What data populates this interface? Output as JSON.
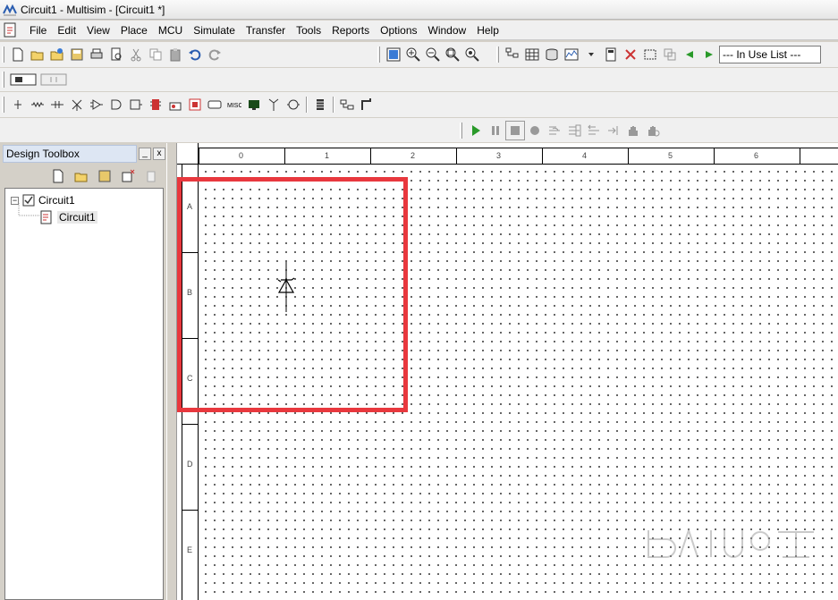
{
  "window": {
    "title": "Circuit1 - Multisim - [Circuit1 *]"
  },
  "menu": [
    "File",
    "Edit",
    "View",
    "Place",
    "MCU",
    "Simulate",
    "Transfer",
    "Tools",
    "Reports",
    "Options",
    "Window",
    "Help"
  ],
  "toolbar": {
    "in_use_list": "--- In Use List ---"
  },
  "toolbox": {
    "title": "Design Toolbox",
    "minimize_label": "_",
    "close_label": "x",
    "tree": {
      "root": "Circuit1",
      "child": "Circuit1"
    }
  },
  "ruler": {
    "columns": [
      "0",
      "1",
      "2",
      "3",
      "4",
      "5",
      "6"
    ],
    "rows": [
      "A",
      "B",
      "C",
      "D",
      "E"
    ]
  },
  "colors": {
    "highlight": "#e8383e",
    "panel_title_bg": "#dde6f3"
  }
}
